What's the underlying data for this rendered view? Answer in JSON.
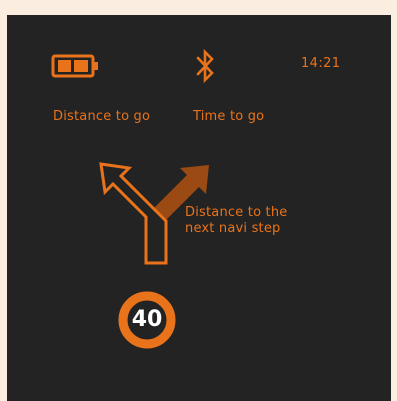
{
  "status_bar": {
    "battery_icon": "battery-icon",
    "bluetooth_icon": "bluetooth-icon",
    "clock": "14:21"
  },
  "labels": {
    "distance_to_go": "Distance to go",
    "time_to_go": "Time to go",
    "next_step_line1": "Distance to the",
    "next_step_line2": "next navi step"
  },
  "maneuver": {
    "icon": "fork-left-arrow-icon"
  },
  "speed_limit": {
    "value": "40",
    "icon": "speed-limit-sign"
  },
  "colors": {
    "screen_background": "#232323",
    "page_background": "#fbeee0",
    "accent_orange": "#e9731b",
    "dim_arrow": "#9a4a12",
    "text_white": "#ffffff"
  }
}
